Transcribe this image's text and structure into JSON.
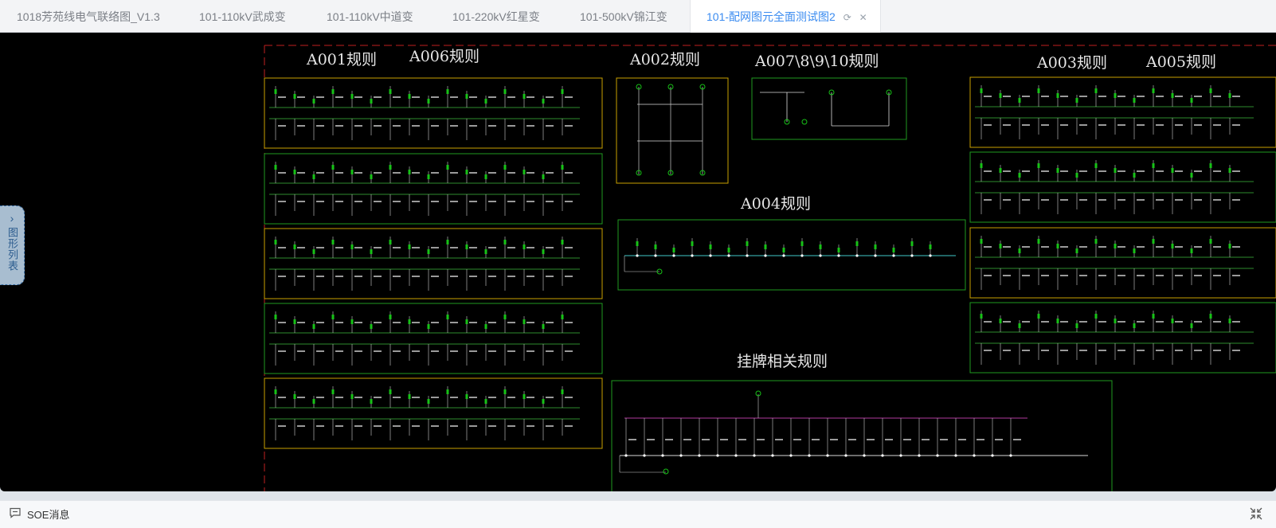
{
  "tabs": [
    {
      "label": "1018芳苑线电气联络图_V1.3",
      "active": false
    },
    {
      "label": "101-110kV武成变",
      "active": false
    },
    {
      "label": "101-110kV中道变",
      "active": false
    },
    {
      "label": "101-220kV红星变",
      "active": false
    },
    {
      "label": "101-500kV锦江变",
      "active": false
    },
    {
      "label": "101-配网图元全面测试图2",
      "active": true
    }
  ],
  "active_tab_icons": [
    "refresh-icon",
    "close-icon"
  ],
  "side_panel": {
    "label": "图形列表",
    "icon": "chevron-right-icon"
  },
  "diagram": {
    "labels": {
      "a001": "A001规则",
      "a006": "A006规则",
      "a002": "A002规则",
      "a007": "A007\\8\\9\\10规则",
      "a003": "A003规则",
      "a005": "A005规则",
      "a004": "A004规则",
      "tag": "挂牌相关规则"
    },
    "colors": {
      "background": "#000000",
      "bus": "#2e8b2e",
      "frame_yellow": "#c8a000",
      "frame_green": "#1f9a1f",
      "boundary": "#c0201f"
    }
  },
  "soe": {
    "label": "SOE消息",
    "icon": "message-icon",
    "action_icon": "collapse-icon"
  },
  "colors": {
    "accent": "#3a8bf0",
    "tab_text": "#7b7f86"
  }
}
